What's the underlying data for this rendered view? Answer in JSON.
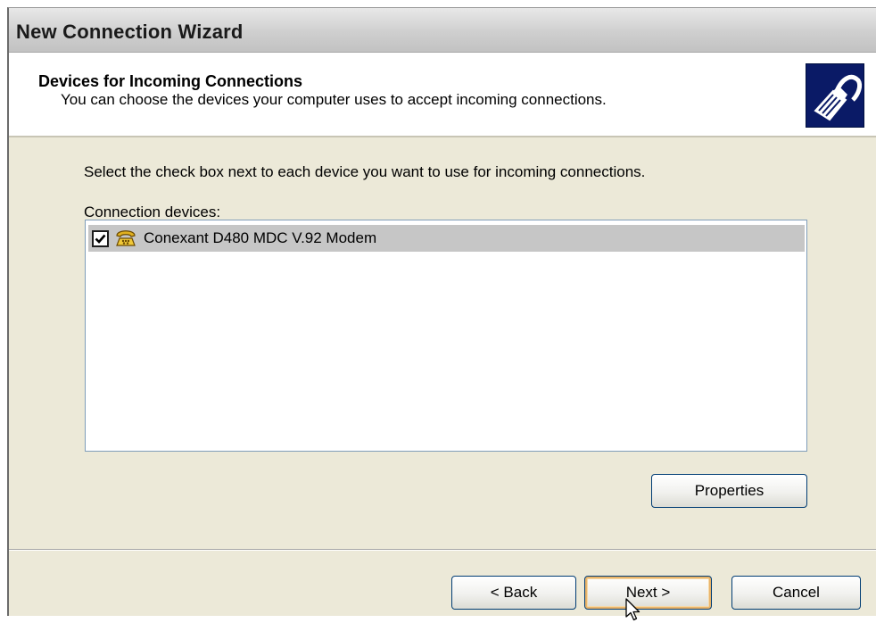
{
  "window": {
    "title": "New Connection Wizard"
  },
  "header": {
    "title": "Devices for Incoming Connections",
    "subtitle": "You can choose the devices your computer uses to accept incoming connections.",
    "icon": "network-cable-icon"
  },
  "main": {
    "instruction": "Select the check box next to each device you want to use for incoming connections.",
    "devices_label": "Connection devices:",
    "devices": [
      {
        "name": "Conexant D480 MDC V.92 Modem",
        "checked": true,
        "selected": true,
        "icon": "modem-phone-icon"
      }
    ],
    "properties_label": "Properties"
  },
  "footer": {
    "back_label": "< Back",
    "next_label": "Next >",
    "cancel_label": "Cancel"
  },
  "colors": {
    "dialog_bg": "#ece9d8",
    "selected_row": "#c6c6c6",
    "list_border": "#7f9db9",
    "button_border": "#003c74",
    "default_button_glow": "#e9b46a",
    "header_icon_bg": "#0a1a66"
  }
}
